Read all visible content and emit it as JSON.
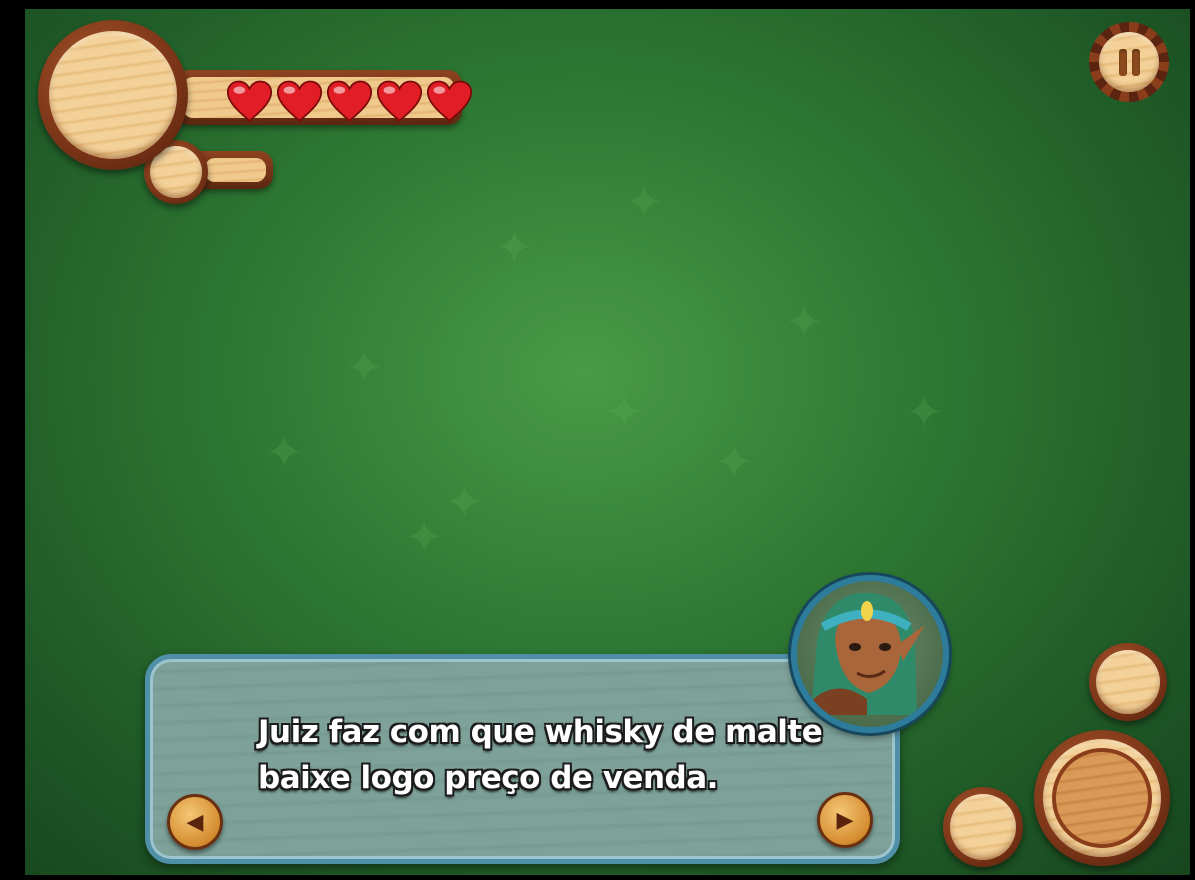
{
  "hud": {
    "lives": 5,
    "heart_icon": "heart-icon",
    "heart_color": "#e11d25",
    "pause_icon": "pause-icon"
  },
  "dialog": {
    "text": "Juiz faz com que whisky de malte\nbaixe logo preço de venda.",
    "prev_icon": "triangle-left-icon",
    "next_icon": "triangle-right-icon",
    "frame_color": "#4f8fa8"
  },
  "colors": {
    "background": "#2f7a34",
    "wood_light": "#f3d199",
    "wood_dark": "#7a3417"
  }
}
